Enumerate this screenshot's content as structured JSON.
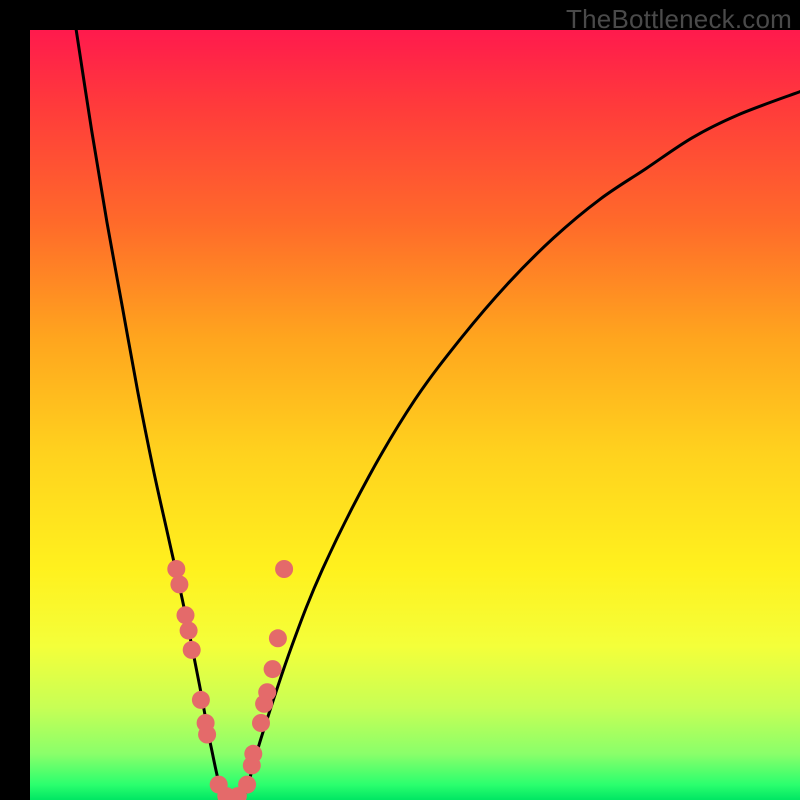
{
  "watermark": "TheBottleneck.com",
  "chart_data": {
    "type": "line",
    "title": "",
    "xlabel": "",
    "ylabel": "",
    "xlim": [
      0,
      100
    ],
    "ylim": [
      0,
      100
    ],
    "series": [
      {
        "name": "bottleneck-curve",
        "x": [
          6,
          8,
          10,
          12,
          14,
          16,
          18,
          20,
          22,
          23.5,
          25,
          27,
          28,
          30,
          34,
          38,
          44,
          50,
          56,
          62,
          68,
          74,
          80,
          86,
          92,
          100
        ],
        "values": [
          100,
          87,
          75,
          64,
          53,
          43,
          34,
          25,
          15,
          7,
          1,
          0,
          1,
          8,
          20,
          30,
          42,
          52,
          60,
          67,
          73,
          78,
          82,
          86,
          89,
          92
        ]
      }
    ],
    "markers": {
      "name": "highlight-points",
      "color": "#e46a6a",
      "x": [
        19.0,
        19.4,
        20.2,
        20.6,
        21.0,
        22.2,
        22.8,
        23.0,
        24.5,
        25.5,
        27.0,
        28.2,
        28.8,
        29.0,
        30.0,
        30.4,
        30.8,
        31.5,
        32.2,
        33.0
      ],
      "values": [
        30.0,
        28.0,
        24.0,
        22.0,
        19.5,
        13.0,
        10.0,
        8.5,
        2.0,
        0.5,
        0.5,
        2.0,
        4.5,
        6.0,
        10.0,
        12.5,
        14.0,
        17.0,
        21.0,
        30.0
      ]
    }
  }
}
